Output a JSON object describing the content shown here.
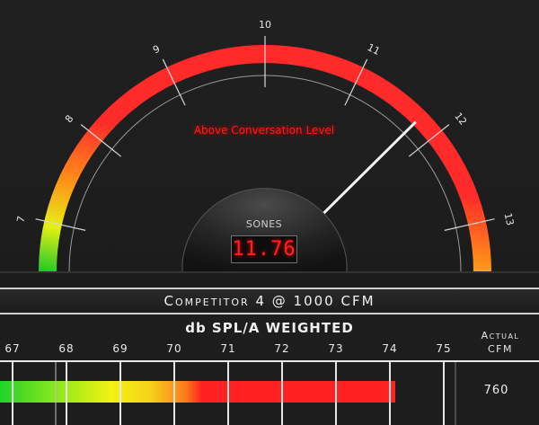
{
  "gauge": {
    "ticks": [
      "7",
      "8",
      "9",
      "10",
      "11",
      "12",
      "13"
    ],
    "zone_label": "Above Conversation Level",
    "unit_label": "SONES",
    "reading": "11.76",
    "reading_value": 11.76,
    "scale_min": 6.5,
    "scale_max": 13.5,
    "colors": {
      "arc_red": "#ff2a2a",
      "arc_green": "#22c22a",
      "arc_yellow": "#f0f010",
      "arc_orange": "#ff7a1a"
    }
  },
  "caption": "Competitor 4 @ 1000 CFM",
  "bar_meter": {
    "title": "db SPL/A WEIGHTED",
    "scale_labels": [
      "67",
      "68",
      "69",
      "70",
      "71",
      "72",
      "73",
      "74",
      "75"
    ],
    "value": 74.1,
    "actual_label": "Actual CFM",
    "actual_value": "760"
  }
}
